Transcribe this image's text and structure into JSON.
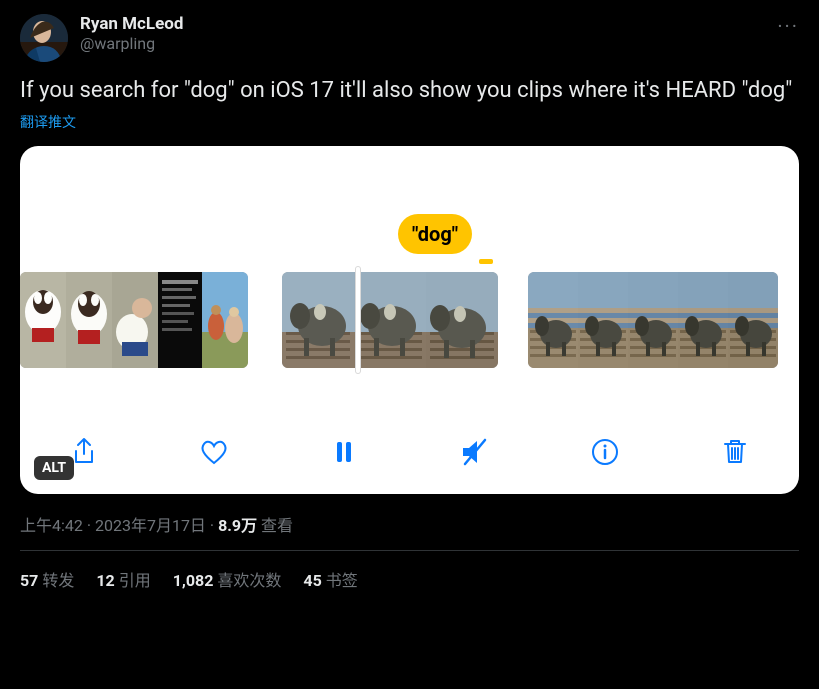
{
  "user": {
    "name": "Ryan McLeod",
    "handle": "@warpling"
  },
  "content": "If you search for \"dog\" on iOS 17 it'll also show you clips where it's HEARD \"dog\"",
  "translate_label": "翻译推文",
  "media": {
    "bubble_text": "\"dog\"",
    "alt_badge": "ALT"
  },
  "meta": {
    "time": "上午4:42",
    "dot1": " · ",
    "date": "2023年7月17日",
    "dot2": " · ",
    "views_count": "8.9万",
    "views_label": " 查看"
  },
  "stats": {
    "retweets_n": "57",
    "retweets_l": "转发",
    "quotes_n": "12",
    "quotes_l": "引用",
    "likes_n": "1,082",
    "likes_l": "喜欢次数",
    "bookmarks_n": "45",
    "bookmarks_l": "书签"
  }
}
